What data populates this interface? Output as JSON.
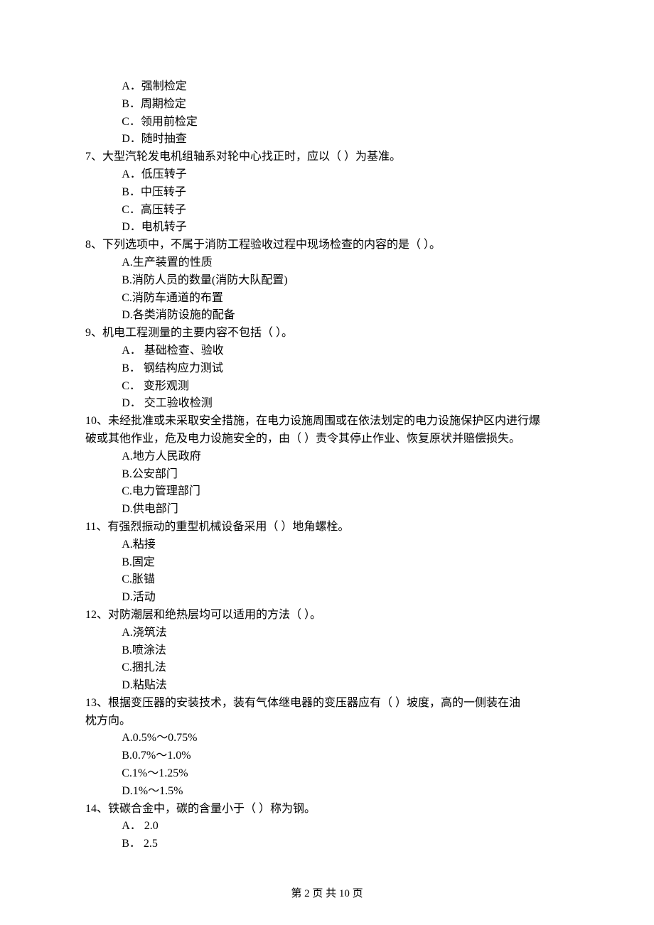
{
  "q6": {
    "options": {
      "a": "A．强制检定",
      "b": "B．周期检定",
      "c": "C．领用前检定",
      "d": "D．随时抽查"
    }
  },
  "q7": {
    "text": "7、大型汽轮发电机组轴系对轮中心找正时，应以（    ）为基准。",
    "options": {
      "a": "A．低压转子",
      "b": "B．中压转子",
      "c": "C．高压转子",
      "d": "D．电机转子"
    }
  },
  "q8": {
    "text": "8、下列选项中，不属于消防工程验收过程中现场检查的内容的是（    ）。",
    "options": {
      "a": "A.生产装置的性质",
      "b": "B.消防人员的数量(消防大队配置)",
      "c": "C.消防车通道的布置",
      "d": "D.各类消防设施的配备"
    }
  },
  "q9": {
    "text": "9、机电工程测量的主要内容不包括（    ）。",
    "options": {
      "a": "A． 基础检查、验收",
      "b": "B． 钢结构应力测试",
      "c": "C． 变形观测",
      "d": "D． 交工验收检测"
    }
  },
  "q10": {
    "text1": "10、未经批准或未采取安全措施，在电力设施周围或在依法划定的电力设施保护区内进行爆",
    "text2": "破或其他作业，危及电力设施安全的，由（    ）责令其停止作业、恢复原状并赔偿损失。",
    "options": {
      "a": "A.地方人民政府",
      "b": "B.公安部门",
      "c": "C.电力管理部门",
      "d": "D.供电部门"
    }
  },
  "q11": {
    "text": "11、有强烈振动的重型机械设备采用（    ）地角螺栓。",
    "options": {
      "a": "A.粘接",
      "b": "B.固定",
      "c": "C.胀锚",
      "d": "D.活动"
    }
  },
  "q12": {
    "text": "12、对防潮层和绝热层均可以适用的方法（    ）。",
    "options": {
      "a": "A.浇筑法",
      "b": "B.喷涂法",
      "c": "C.捆扎法",
      "d": "D.粘贴法"
    }
  },
  "q13": {
    "text1": "13、根据变压器的安装技术，装有气体继电器的变压器应有（    ）坡度，高的一侧装在油",
    "text2": "枕方向。",
    "options": {
      "a": "A.0.5%～0.75%",
      "b": "B.0.7%～1.0%",
      "c": "C.1%～1.25%",
      "d": "D.1%～1.5%"
    }
  },
  "q14": {
    "text": "14、铁碳合金中，碳的含量小于（    ）称为钢。",
    "options": {
      "a": "A． 2.0",
      "b": "B． 2.5"
    }
  },
  "footer": "第 2 页 共 10 页"
}
